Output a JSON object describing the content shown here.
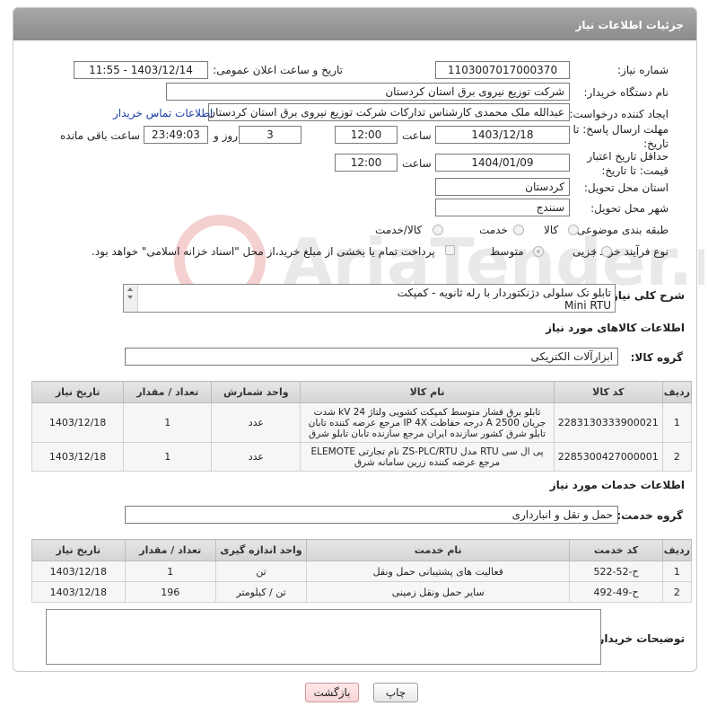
{
  "header": {
    "title": "جزئیات اطلاعات نیاز"
  },
  "form": {
    "need_number_label": "شماره نیاز:",
    "need_number": "1103007017000370",
    "announce_label": "تاریخ و ساعت اعلان عمومی:",
    "announce_value": "1403/12/14 - 11:55",
    "buyer_org_label": "نام دستگاه خریدار:",
    "buyer_org": "شرکت توزیع نیروی برق استان کردستان",
    "creator_label": "ایجاد کننده درخواست:",
    "creator": "عبدالله ملک محمدی کارشناس تدارکات شرکت توزیع نیروی برق استان کردستان",
    "contact_link": "اطلاعات تماس خریدار",
    "deadline_label": "مهلت ارسال پاسخ: تا تاریخ:",
    "deadline_date": "1403/12/18",
    "time_label": "ساعت",
    "deadline_time": "12:00",
    "days_value": "3",
    "days_label": "روز و",
    "remaining_time": "23:49:03",
    "remaining_label": "ساعت باقی مانده",
    "price_validity_label": "حداقل تاریخ اعتبار قیمت: تا تاریخ:",
    "price_validity_date": "1404/01/09",
    "price_validity_time": "12:00",
    "province_label": "استان محل تحویل:",
    "province": "کردستان",
    "city_label": "شهر محل تحویل:",
    "city": "سنندج",
    "category_label": "طبقه بندی موضوعی:",
    "category_options": [
      "کالا",
      "خدمت",
      "کالا/خدمت"
    ],
    "purchase_type_label": "نوع فرآیند خرید :",
    "purchase_options": [
      "جزیی",
      "متوسط"
    ],
    "payment_note": "پرداخت تمام یا بخشی از مبلغ خرید،از محل \"اسناد خزانه اسلامی\" خواهد بود."
  },
  "description": {
    "label": "شرح کلی نیاز:",
    "line1": "تابلو تک سلولی دژنکتوردار با رله ثانویه - کمپکت",
    "line2": "Mini RTU"
  },
  "goods": {
    "section_title": "اطلاعات کالاهای مورد نیاز",
    "group_label": "گروه کالا:",
    "group_value": "ابزارآلات الکتریکی",
    "columns": [
      "ردیف",
      "کد کالا",
      "نام کالا",
      "واحد شمارش",
      "تعداد / مقدار",
      "تاریخ نیاز"
    ],
    "rows": [
      {
        "row": "1",
        "code": "2283130333900021",
        "name": "تابلو برق فشار متوسط کمپکت کشویی ولتاژ 24 kV شدت جریان 2500 A درجه حفاظت IP 4X مرجع عرضه کننده تابان تابلو شرق کشور سازنده ایران مرجع سازنده تابان تابلو شرق",
        "unit": "عدد",
        "qty": "1",
        "date": "1403/12/18"
      },
      {
        "row": "2",
        "code": "2285300427000001",
        "name": "پی ال سی RTU مدل ZS-PLC/RTU نام تجارتی ELEMOTE مرجع عرضه کننده زرین سامانه شرق",
        "unit": "عدد",
        "qty": "1",
        "date": "1403/12/18"
      }
    ]
  },
  "services": {
    "section_title": "اطلاعات خدمات مورد نیاز",
    "group_label": "گروه خدمت:",
    "group_value": "حمل و نقل و انبارداری",
    "columns": [
      "ردیف",
      "کد خدمت",
      "نام خدمت",
      "واحد اندازه گیری",
      "تعداد / مقدار",
      "تاریخ نیاز"
    ],
    "rows": [
      {
        "row": "1",
        "code": "ح-52-522",
        "name": "فعالیت های پشتیبانی حمل ونقل",
        "unit": "تن",
        "qty": "1",
        "date": "1403/12/18"
      },
      {
        "row": "2",
        "code": "ح-49-492",
        "name": "سایر حمل ونقل زمینی",
        "unit": "تن / کیلومتر",
        "qty": "196",
        "date": "1403/12/18"
      }
    ]
  },
  "buyer_notes": {
    "label": "توضیحات خریدار:",
    "value": ""
  },
  "buttons": {
    "print": "چاپ",
    "back": "بازگشت"
  },
  "watermark": {
    "text": "AriaTender.neT"
  }
}
